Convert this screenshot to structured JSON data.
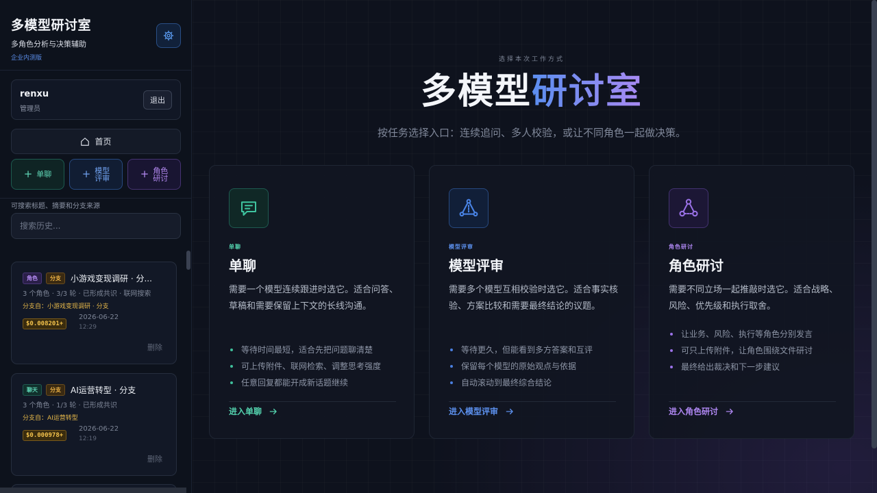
{
  "sidebar": {
    "title": "多模型研讨室",
    "subtitle": "多角色分析与决策辅助",
    "edition": "企业内测版",
    "user": {
      "name": "renxu",
      "role": "管理员",
      "logout_label": "退出"
    },
    "home_label": "首页",
    "modes": [
      {
        "label": "单聊",
        "label_l1": "单聊",
        "label_l2": ""
      },
      {
        "label": "模型评审",
        "label_l1": "模型",
        "label_l2": "评审"
      },
      {
        "label": "角色研讨",
        "label_l1": "角色",
        "label_l2": "研讨"
      }
    ],
    "search_hint": "可搜索标题、摘要和分支来源",
    "search_placeholder": "搜索历史...",
    "history": [
      {
        "tags": [
          "角色",
          "分支"
        ],
        "title": "小游戏变现调研 · 分...",
        "meta": "3 个角色 · 3/3 轮 · 已形成共识 · 联网搜索",
        "branch_from": "分支自：小游戏变现调研 · 分支",
        "cost": "$0.008201+",
        "date": "2026-06-22",
        "time": "12:29",
        "delete_label": "删除"
      },
      {
        "tags": [
          "聊天",
          "分支"
        ],
        "title": "AI运营转型 · 分支",
        "meta": "3 个角色 · 1/3 轮 · 已形成共识",
        "branch_from": "分支自：AI运营转型",
        "cost": "$0.000978+",
        "date": "2026-06-22",
        "time": "12:19",
        "delete_label": "删除"
      }
    ]
  },
  "main": {
    "kicker": "选择本次工作方式",
    "hero_white": "多模型",
    "hero_gradient": "研讨室",
    "subtitle": "按任务选择入口：连续追问、多人校验，或让不同角色一起做决策。",
    "cards": [
      {
        "icon": "chat-bubble-icon",
        "kicker": "单聊",
        "title": "单聊",
        "description": "需要一个模型连续跟进时选它。适合问答、草稿和需要保留上下文的长线沟通。",
        "bullets": [
          "等待时间最短，适合先把问题聊清楚",
          "可上传附件、联网检索、调整思考强度",
          "任意回复都能开成新话题继续"
        ],
        "link": "进入单聊"
      },
      {
        "icon": "triangle-network-icon",
        "kicker": "模型评审",
        "title": "模型评审",
        "description": "需要多个模型互相校验时选它。适合事实核验、方案比较和需要最终结论的议题。",
        "bullets": [
          "等待更久，但能看到多方答案和互评",
          "保留每个模型的原始观点与依据",
          "自动滚动到最终综合结论"
        ],
        "link": "进入模型评审"
      },
      {
        "icon": "role-network-icon",
        "kicker": "角色研讨",
        "title": "角色研讨",
        "description": "需要不同立场一起推敲时选它。适合战略、风险、优先级和执行取舍。",
        "bullets": [
          "让业务、风险、执行等角色分别发言",
          "可只上传附件，让角色围绕文件研讨",
          "最终给出裁决和下一步建议"
        ],
        "link": "进入角色研讨"
      }
    ]
  },
  "colors": {
    "chat_accent": "#53d1ad",
    "review_accent": "#5b8fec",
    "role_accent": "#ad86f0",
    "cost_accent": "#f3c24c"
  }
}
